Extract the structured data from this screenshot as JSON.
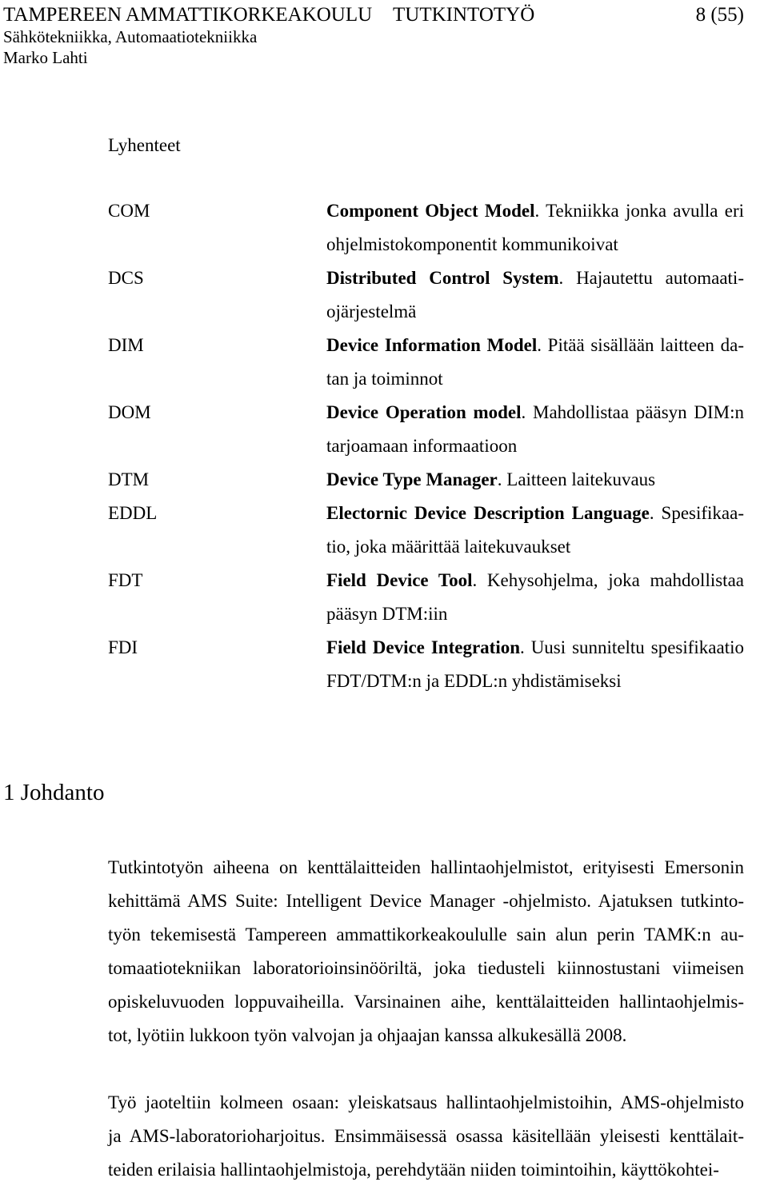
{
  "document": {
    "header": {
      "organization": "TAMPEREEN AMMATTIKORKEAKOULU",
      "doc_type": "TUTKINTOTYÖ",
      "page_number": "8 (55)",
      "department": "Sähkötekniikka, Automaatiotekniikka",
      "author": "Marko Lahti"
    },
    "abbreviations": {
      "heading": "Lyhenteet",
      "items": [
        {
          "term": "COM",
          "expansion": "Component Object Model",
          "line1_rest": ". Tekniikka jonka avulla eri",
          "line2": "ohjelmistokomponentit kommunikoivat"
        },
        {
          "term": "DCS",
          "expansion": "Distributed Control System",
          "line1_rest": ". Hajautettu automaati-",
          "line2": "ojärjestelmä"
        },
        {
          "term": "DIM",
          "expansion": "Device Information Model",
          "line1_rest": ". Pitää sisällään laitteen da-",
          "line2": "tan ja toiminnot"
        },
        {
          "term": "DOM",
          "expansion": "Device Operation model",
          "line1_rest": ". Mahdollistaa pääsyn DIM:n",
          "line2": "tarjoamaan informaatioon"
        },
        {
          "term": "DTM",
          "expansion": "Device Type Manager",
          "line1_rest": ". Laitteen laitekuvaus",
          "line2": ""
        },
        {
          "term": "EDDL",
          "expansion": "Electornic Device Description Language",
          "line1_rest": ". Spesifikaa-",
          "line2": "tio, joka määrittää laitekuvaukset"
        },
        {
          "term": "FDT",
          "expansion": "Field Device Tool",
          "line1_rest": ". Kehysohjelma, joka mahdollistaa",
          "line2": "pääsyn DTM:iin"
        },
        {
          "term": "FDI",
          "expansion": "Field Device Integration",
          "line1_rest": ". Uusi sunniteltu spesifikaatio",
          "line2": "FDT/DTM:n ja EDDL:n yhdistämiseksi"
        }
      ]
    },
    "chapter": {
      "heading": "1 Johdanto",
      "paragraphs": [
        {
          "lines": [
            "Tutkintotyön aiheena on kenttälaitteiden hallintaohjelmistot, erityisesti Emersonin",
            "kehittämä AMS Suite: Intelligent Device Manager -ohjelmisto. Ajatuksen tutkinto-",
            "työn tekemisestä Tampereen ammattikorkeakoululle sain alun perin TAMK:n au-",
            "tomaatiotekniikan laboratorioinsinööriltä, joka tiedusteli kiinnostustani viimeisen",
            "opiskeluvuoden loppuvaiheilla. Varsinainen aihe, kenttälaitteiden hallintaohjelmis-",
            "tot, lyötiin lukkoon työn valvojan ja ohjaajan kanssa alkukesällä 2008."
          ]
        },
        {
          "lines": [
            "Työ jaoteltiin kolmeen osaan: yleiskatsaus hallintaohjelmistoihin, AMS-ohjelmisto",
            "ja AMS-laboratorioharjoitus. Ensimmäisessä osassa käsitellään yleisesti kenttälait-",
            "teiden erilaisia hallintaohjelmistoja, perehdytään niiden toimintoihin, käyttökohtei-"
          ]
        }
      ]
    }
  }
}
